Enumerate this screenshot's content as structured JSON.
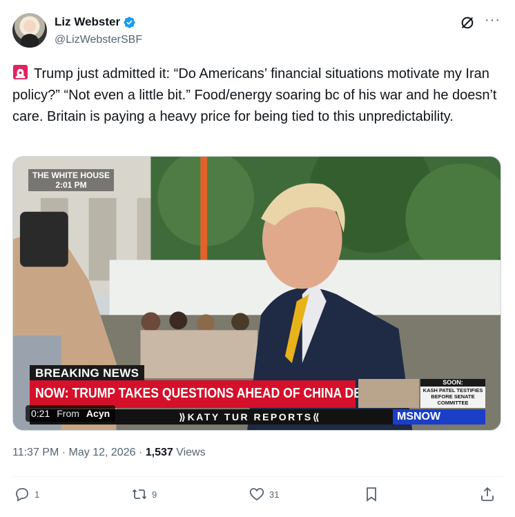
{
  "author": {
    "display_name": "Liz Webster",
    "handle": "@LizWebsterSBF",
    "verified": true
  },
  "tweet": {
    "emoji": "siren-icon",
    "text": "Trump just admitted it: “Do Americans’ financial situations motivate my Iran policy?” “Not even a little bit.” Food/energy soaring bc of his war and he doesn’t care. Britain is paying a heavy price for being tied to this unpredictability."
  },
  "media": {
    "location_bug_line1": "THE WHITE HOUSE",
    "location_bug_line2": "2:01 PM",
    "breaking_label": "BREAKING NEWS",
    "headline": "NOW: TRUMP TAKES QUESTIONS AHEAD OF CHINA DEPARTURE",
    "show_name": "⟫KATY TUR REPORTS⟪",
    "network": "MSNOW",
    "soon_label": "SOON:",
    "soon_text": "KASH PATEL TESTIFIES BEFORE SENATE COMMITTEE",
    "video_time": "0:21",
    "video_from_label": "From",
    "video_source": "Acyn"
  },
  "meta": {
    "time": "11:37 PM",
    "date": "May 12, 2026",
    "views": "1,537",
    "views_label": "Views"
  },
  "actions": {
    "replies": "1",
    "reposts": "9",
    "likes": "31"
  },
  "colors": {
    "verified_blue": "#1d9bf0",
    "secondary_text": "#536471",
    "headline_red": "#d4102a",
    "network_blue": "#1a3ec7"
  }
}
